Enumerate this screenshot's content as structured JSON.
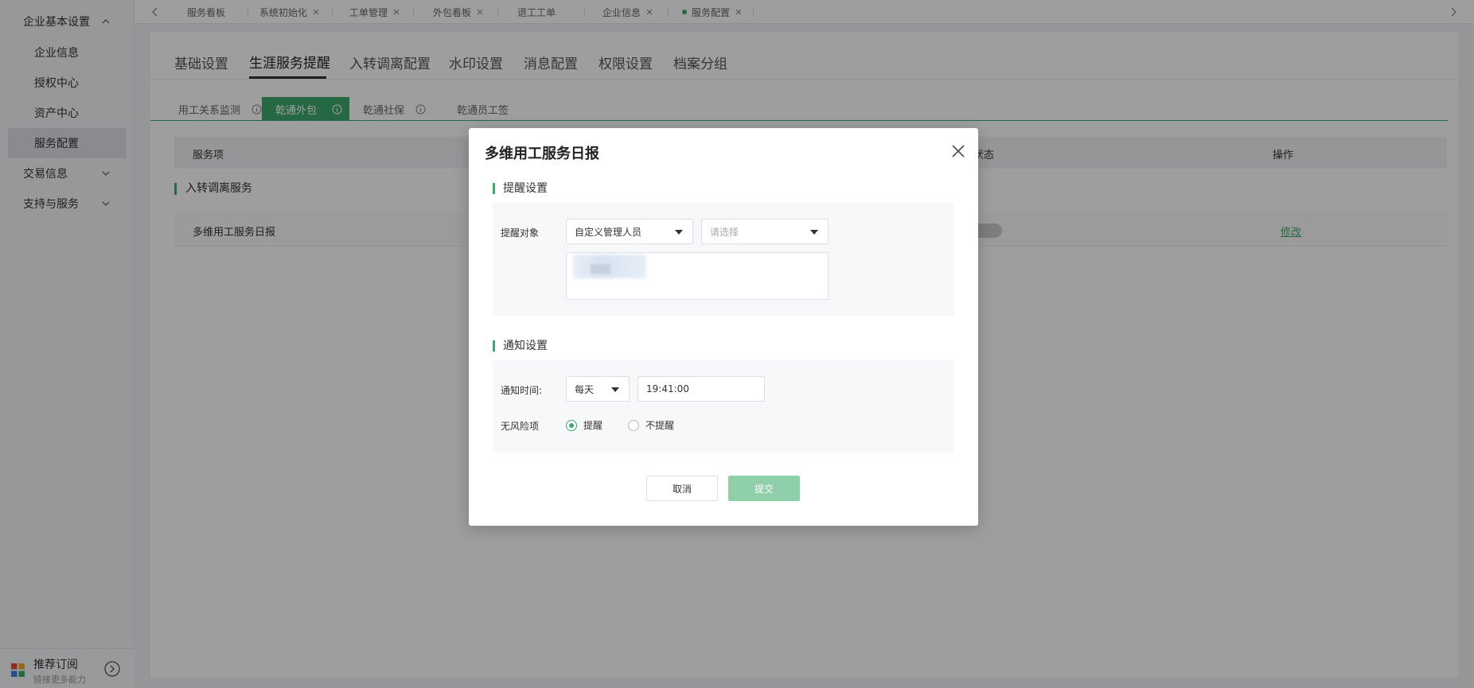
{
  "sidebar": {
    "groups": [
      {
        "label": "企业基本设置",
        "expanded": true,
        "items": [
          "企业信息",
          "授权中心",
          "资产中心",
          "服务配置"
        ],
        "active_item": "服务配置"
      },
      {
        "label": "交易信息",
        "expanded": false
      },
      {
        "label": "支持与服务",
        "expanded": false
      }
    ],
    "bottom": {
      "title": "推荐订阅",
      "subtitle": "链接更多能力"
    }
  },
  "tabs": [
    {
      "label": "服务看板",
      "closable": false
    },
    {
      "label": "系统初始化",
      "closable": true
    },
    {
      "label": "工单管理",
      "closable": true
    },
    {
      "label": "外包看板",
      "closable": true
    },
    {
      "label": "退工工单",
      "closable": false
    },
    {
      "label": "企业信息",
      "closable": true
    },
    {
      "label": "服务配置",
      "closable": true,
      "active": true
    }
  ],
  "subtabs": [
    "基础设置",
    "生涯服务提醒",
    "入转调离配置",
    "水印设置",
    "消息配置",
    "权限设置",
    "档案分组"
  ],
  "active_subtab": "生涯服务提醒",
  "pills": [
    {
      "label": "用工关系监测",
      "info": true
    },
    {
      "label": "乾通外包",
      "info": true,
      "active": true
    },
    {
      "label": "乾通社保",
      "info": true
    },
    {
      "label": "乾通员工签",
      "info": false
    }
  ],
  "table": {
    "headers": [
      "服务项",
      "状态",
      "操作"
    ],
    "section": "入转调离服务",
    "rows": [
      {
        "name": "多维用工服务日报",
        "action": "修改"
      }
    ]
  },
  "modal": {
    "title": "多维用工服务日报",
    "reminder_section": "提醒设置",
    "reminder_target_label": "提醒对象",
    "reminder_target_value": "自定义管理人员",
    "reminder_select_placeholder": "请选择",
    "notify_section": "通知设置",
    "notify_time_label": "通知时间:",
    "frequency_value": "每天",
    "time_value": "19:41:00",
    "no_risk_label": "无风险项",
    "radio_remind": "提醒",
    "radio_no_remind": "不提醒",
    "cancel_label": "取消",
    "submit_label": "提交"
  },
  "colors": {
    "accent": "#3daa6e",
    "submit_disabled": "#8fd0aa"
  }
}
